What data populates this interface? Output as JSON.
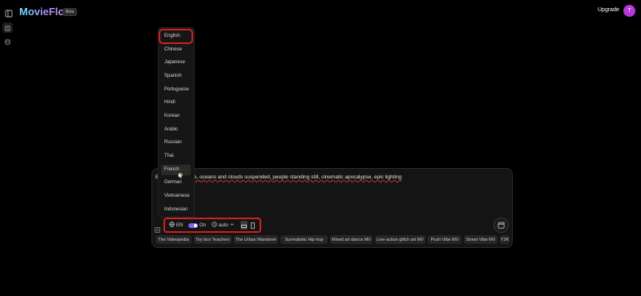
{
  "header": {
    "app_name": "MovieFlow",
    "badge": "Beta",
    "upgrade_label": "Upgrade",
    "avatar_initial": "T"
  },
  "sidebar": {
    "items": [
      {
        "icon": "document-icon",
        "active": true
      },
      {
        "icon": "box-icon",
        "active": false
      }
    ]
  },
  "language_menu": {
    "selected": "English",
    "hovered": "French",
    "items": [
      "English",
      "Chinese",
      "Japanese",
      "Spanish",
      "Portuguese",
      "Hindi",
      "Korean",
      "Arabic",
      "Russian",
      "Thai",
      "French",
      "German",
      "Vietnamese",
      "Indonesian"
    ]
  },
  "prompt": {
    "prefix": "E",
    "text": "space, oceans and clouds suspended, people standing still, cinematic apocalypse, epic lighting"
  },
  "toolbar": {
    "language": "EN",
    "toggle_label": "On",
    "toggle_on": true,
    "duration": "auto"
  },
  "style_chips": [
    "The Videopedia",
    "Toy box Teachers",
    "The Urban Wanderer",
    "Surrealistic Hip-hop",
    "Mixed art dance MV",
    "Live-action glitch art MV",
    "Posh Vibe MV",
    "Street Vibe MV",
    "Y2K"
  ],
  "colors": {
    "accent": "#8b5cf6",
    "highlight": "#d21f1f",
    "avatar": "#b638d9"
  }
}
